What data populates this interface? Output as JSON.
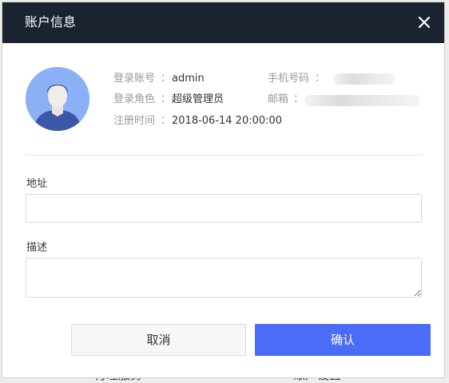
{
  "background": {
    "partial_texts": [
      "付理服务",
      "账户设置"
    ]
  },
  "dialog": {
    "title": "账户信息",
    "close_icon": "close-icon",
    "avatar_icon": "user-avatar-icon",
    "info": {
      "account_label": "登录账号",
      "account_value": "admin",
      "role_label": "登录角色",
      "role_value": "超级管理员",
      "register_label": "注册时间",
      "register_value": "2018-06-14 20:00:00",
      "phone_label": "手机号码",
      "email_label": "邮箱",
      "separator": "："
    },
    "form": {
      "address_label": "地址",
      "address_value": "",
      "description_label": "描述",
      "description_value": ""
    },
    "buttons": {
      "cancel": "取消",
      "confirm": "确认"
    },
    "colors": {
      "header_bg": "#1b2230",
      "primary": "#4a6cf7",
      "avatar_bg": "#8bb0f6"
    }
  }
}
